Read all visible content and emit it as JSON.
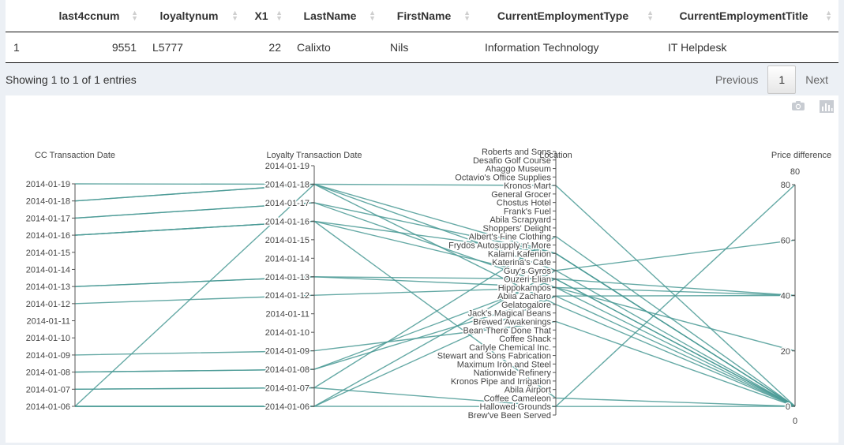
{
  "table": {
    "columns": [
      "",
      "last4ccnum",
      "loyaltynum",
      "X1",
      "LastName",
      "FirstName",
      "CurrentEmploymentType",
      "CurrentEmploymentTitle"
    ],
    "rows": [
      [
        "1",
        "9551",
        "L5777",
        "22",
        "Calixto",
        "Nils",
        "Information Technology",
        "IT Helpdesk"
      ]
    ]
  },
  "info": "Showing 1 to 1 of 1 entries",
  "pager": {
    "previous": "Previous",
    "page": "1",
    "next": "Next"
  },
  "modebar": {
    "camera_icon": "camera-icon",
    "plotly_icon": "bar-chart-icon"
  },
  "chart_data": {
    "type": "parcoords",
    "line_color": "#4a9a95",
    "dimensions": [
      {
        "label": "CC Transaction Date",
        "ticks": [
          "2014-01-06",
          "2014-01-07",
          "2014-01-08",
          "2014-01-09",
          "2014-01-10",
          "2014-01-11",
          "2014-01-12",
          "2014-01-13",
          "2014-01-14",
          "2014-01-15",
          "2014-01-16",
          "2014-01-17",
          "2014-01-18",
          "2014-01-19"
        ]
      },
      {
        "label": "Loyalty Transaction Date",
        "ticks": [
          "2014-01-06",
          "2014-01-07",
          "2014-01-08",
          "2014-01-09",
          "2014-01-10",
          "2014-01-11",
          "2014-01-12",
          "2014-01-13",
          "2014-01-14",
          "2014-01-15",
          "2014-01-16",
          "2014-01-17",
          "2014-01-18",
          "2014-01-19"
        ]
      },
      {
        "label": "Location",
        "ticks": [
          "Brew've Been Served",
          "Hallowed Grounds",
          "Coffee Cameleon",
          "Abila Airport",
          "Kronos Pipe and Irrigation",
          "Nationwide Refinery",
          "Maximum Iron and Steel",
          "Stewart and Sons Fabrication",
          "Carlyle Chemical Inc.",
          "Coffee Shack",
          "Bean There Done That",
          "Brewed Awakenings",
          "Jack's Magical Beans",
          "Gelatogalore",
          "Abila Zacharo",
          "Hippokampos",
          "Ouzeri Elian",
          "Guy's Gyros",
          "Katerina's Cafe",
          "Kalami Kafenion",
          "Frydos Autosupply n' More",
          "Albert's Fine Clothing",
          "Shoppers' Delight",
          "Abila Scrapyard",
          "Frank's Fuel",
          "Chostus Hotel",
          "General Grocer",
          "Kronos Mart",
          "Octavio's Office Supplies",
          "Ahaggo Museum",
          "Desafio Golf Course",
          "Roberts and Sons"
        ]
      },
      {
        "label": "Price difference",
        "range": [
          0,
          80
        ],
        "ticks": [
          0,
          20,
          40,
          60,
          80
        ],
        "range_labels": [
          "0",
          "80"
        ]
      }
    ],
    "records": [
      [
        "2014-01-19",
        "2014-01-18",
        "Kronos Mart",
        0
      ],
      [
        "2014-01-18",
        "2014-01-18",
        "Kalami Kafenion",
        0
      ],
      [
        "2014-01-18",
        "2014-01-18",
        "Guy's Gyros",
        0
      ],
      [
        "2014-01-17",
        "2014-01-17",
        "Kalami Kafenion",
        0
      ],
      [
        "2014-01-17",
        "2014-01-17",
        "Hippokampos",
        0
      ],
      [
        "2014-01-16",
        "2014-01-16",
        "Kalami Kafenion",
        0
      ],
      [
        "2014-01-16",
        "2014-01-16",
        "Ouzeri Elian",
        0
      ],
      [
        "2014-01-16",
        "2014-01-16",
        "Coffee Cameleon",
        0
      ],
      [
        "2014-01-13",
        "2014-01-13",
        "Ouzeri Elian",
        40
      ],
      [
        "2014-01-13",
        "2014-01-13",
        "Hippokampos",
        20
      ],
      [
        "2014-01-12",
        "2014-01-12",
        "Hippokampos",
        40
      ],
      [
        "2014-01-09",
        "2014-01-09",
        "Brewed Awakenings",
        0
      ],
      [
        "2014-01-08",
        "2014-01-08",
        "Ouzeri Elian",
        0
      ],
      [
        "2014-01-08",
        "2014-01-08",
        "Abila Zacharo",
        0
      ],
      [
        "2014-01-07",
        "2014-01-07",
        "Albert's Fine Clothing",
        0
      ],
      [
        "2014-01-07",
        "2014-01-07",
        "Hallowed Grounds",
        80
      ],
      [
        "2014-01-06",
        "2014-01-06",
        "Hallowed Grounds",
        0
      ],
      [
        "2014-01-06",
        "2014-01-18",
        "Gelatogalore",
        0
      ],
      [
        "2014-01-06",
        "2014-01-06",
        "Guy's Gyros",
        60
      ],
      [
        "2014-01-06",
        "2014-01-06",
        "Abila Zacharo",
        40
      ]
    ]
  }
}
